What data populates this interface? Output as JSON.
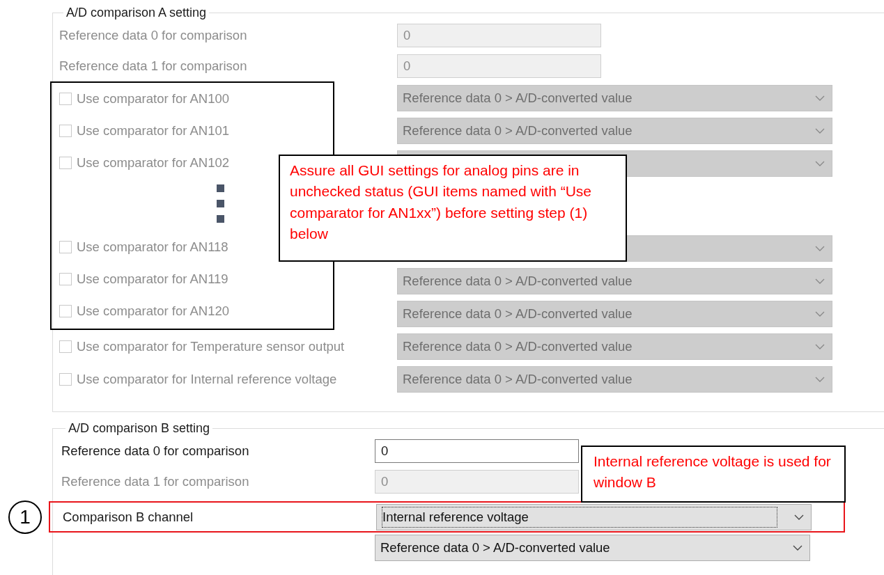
{
  "group_a": {
    "title": "A/D comparison A setting",
    "reference_fields": [
      {
        "label": "Reference data 0 for comparison",
        "value": "0",
        "disabled": true
      },
      {
        "label": "Reference data 1 for comparison",
        "value": "0",
        "disabled": true
      }
    ],
    "annotation_frame": {
      "comparators_top": [
        {
          "label": "Use comparator for AN100",
          "checked": false,
          "disabled": true,
          "dropdown": "Reference data 0 > A/D-converted value"
        },
        {
          "label": "Use comparator for AN101",
          "checked": false,
          "disabled": true,
          "dropdown": "Reference data 0 > A/D-converted value"
        },
        {
          "label": "Use comparator for AN102",
          "checked": false,
          "disabled": true
        }
      ],
      "comparators_bottom": [
        {
          "label": "Use comparator for AN118",
          "checked": false,
          "disabled": true
        },
        {
          "label": "Use comparator for AN119",
          "checked": false,
          "disabled": true,
          "dropdown": "Reference data 0 > A/D-converted value"
        },
        {
          "label": "Use comparator for AN120",
          "checked": false,
          "disabled": true,
          "dropdown": "Reference data 0 > A/D-converted value"
        }
      ]
    },
    "other_comparators": [
      {
        "label": "Use comparator for Temperature sensor output",
        "checked": false,
        "disabled": true,
        "dropdown": "Reference data 0 > A/D-converted value"
      },
      {
        "label": "Use comparator for Internal reference voltage",
        "checked": false,
        "disabled": true,
        "dropdown": "Reference data 0 > A/D-converted value"
      }
    ],
    "callout": "Assure all GUI settings for analog pins are in unchecked status (GUI items named with “Use comparator for AN1xx”) before setting step (1) below"
  },
  "group_b": {
    "title": "A/D comparison B setting",
    "reference_fields": [
      {
        "label": "Reference data 0 for comparison",
        "value": "0",
        "disabled": false
      },
      {
        "label": "Reference data 1 for comparison",
        "value": "0",
        "disabled": true
      }
    ],
    "channel": {
      "label": "Comparison B channel",
      "value": "Internal reference voltage",
      "highlighted": true,
      "step_marker": "1"
    },
    "condition": {
      "value": "Reference data 0 > A/D-converted value"
    },
    "callout": "Internal reference voltage is used for window B"
  }
}
